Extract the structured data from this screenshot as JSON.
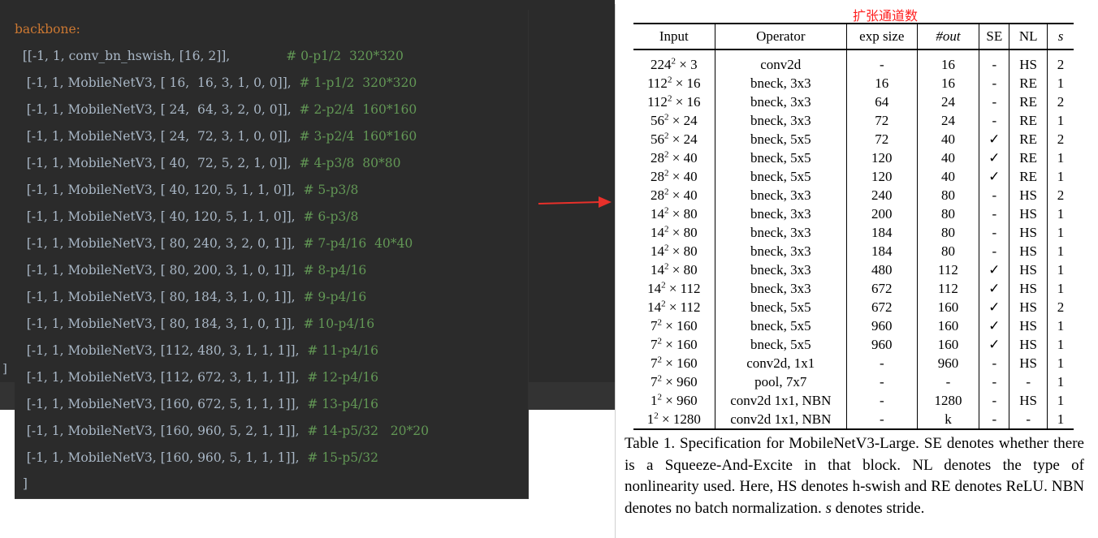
{
  "editor": {
    "header_line": "backbone:",
    "lines": [
      {
        "code": "  [[-1, 1, conv_bn_hswish, [16, 2]],              ",
        "comment": "# 0-p1/2  320*320"
      },
      {
        "code": "   [-1, 1, MobileNetV3, [ 16,  16, 3, 1, 0, 0]],  ",
        "comment": "# 1-p1/2  320*320"
      },
      {
        "code": "   [-1, 1, MobileNetV3, [ 24,  64, 3, 2, 0, 0]],  ",
        "comment": "# 2-p2/4  160*160"
      },
      {
        "code": "   [-1, 1, MobileNetV3, [ 24,  72, 3, 1, 0, 0]],  ",
        "comment": "# 3-p2/4  160*160"
      },
      {
        "code": "   [-1, 1, MobileNetV3, [ 40,  72, 5, 2, 1, 0]],  ",
        "comment": "# 4-p3/8  80*80"
      },
      {
        "code": "   [-1, 1, MobileNetV3, [ 40, 120, 5, 1, 1, 0]],  ",
        "comment": "# 5-p3/8"
      },
      {
        "code": "   [-1, 1, MobileNetV3, [ 40, 120, 5, 1, 1, 0]],  ",
        "comment": "# 6-p3/8"
      },
      {
        "code": "   [-1, 1, MobileNetV3, [ 80, 240, 3, 2, 0, 1]],  ",
        "comment": "# 7-p4/16  40*40"
      },
      {
        "code": "   [-1, 1, MobileNetV3, [ 80, 200, 3, 1, 0, 1]],  ",
        "comment": "# 8-p4/16"
      },
      {
        "code": "   [-1, 1, MobileNetV3, [ 80, 184, 3, 1, 0, 1]],  ",
        "comment": "# 9-p4/16"
      },
      {
        "code": "   [-1, 1, MobileNetV3, [ 80, 184, 3, 1, 0, 1]],  ",
        "comment": "# 10-p4/16"
      },
      {
        "code": "   [-1, 1, MobileNetV3, [112, 480, 3, 1, 1, 1]],  ",
        "comment": "# 11-p4/16"
      },
      {
        "code": "   [-1, 1, MobileNetV3, [112, 672, 3, 1, 1, 1]],  ",
        "comment": "# 12-p4/16"
      },
      {
        "code": "   [-1, 1, MobileNetV3, [160, 672, 5, 1, 1, 1]],  ",
        "comment": "# 13-p4/16"
      },
      {
        "code": "   [-1, 1, MobileNetV3, [160, 960, 5, 2, 1, 1]],  ",
        "comment": "# 14-p5/32   20*20"
      },
      {
        "code": "   [-1, 1, MobileNetV3, [160, 960, 5, 1, 1, 1]],  ",
        "comment": "# 15-p5/32"
      }
    ],
    "closing_line": "  ]",
    "gutter_bracket": "]"
  },
  "annotation": "扩张通道数",
  "table": {
    "headers": [
      "Input",
      "Operator",
      "exp size",
      "#out",
      "SE",
      "NL",
      "s"
    ],
    "rows": [
      {
        "base": "224",
        "exp": "2",
        "mult": "3",
        "op": "conv2d",
        "es": "-",
        "out": "16",
        "se": "-",
        "nl": "HS",
        "s": "2"
      },
      {
        "base": "112",
        "exp": "2",
        "mult": "16",
        "op": "bneck, 3x3",
        "es": "16",
        "out": "16",
        "se": "-",
        "nl": "RE",
        "s": "1"
      },
      {
        "base": "112",
        "exp": "2",
        "mult": "16",
        "op": "bneck, 3x3",
        "es": "64",
        "out": "24",
        "se": "-",
        "nl": "RE",
        "s": "2"
      },
      {
        "base": "56",
        "exp": "2",
        "mult": "24",
        "op": "bneck, 3x3",
        "es": "72",
        "out": "24",
        "se": "-",
        "nl": "RE",
        "s": "1"
      },
      {
        "base": "56",
        "exp": "2",
        "mult": "24",
        "op": "bneck, 5x5",
        "es": "72",
        "out": "40",
        "se": "✓",
        "nl": "RE",
        "s": "2"
      },
      {
        "base": "28",
        "exp": "2",
        "mult": "40",
        "op": "bneck, 5x5",
        "es": "120",
        "out": "40",
        "se": "✓",
        "nl": "RE",
        "s": "1"
      },
      {
        "base": "28",
        "exp": "2",
        "mult": "40",
        "op": "bneck, 5x5",
        "es": "120",
        "out": "40",
        "se": "✓",
        "nl": "RE",
        "s": "1"
      },
      {
        "base": "28",
        "exp": "2",
        "mult": "40",
        "op": "bneck, 3x3",
        "es": "240",
        "out": "80",
        "se": "-",
        "nl": "HS",
        "s": "2"
      },
      {
        "base": "14",
        "exp": "2",
        "mult": "80",
        "op": "bneck, 3x3",
        "es": "200",
        "out": "80",
        "se": "-",
        "nl": "HS",
        "s": "1"
      },
      {
        "base": "14",
        "exp": "2",
        "mult": "80",
        "op": "bneck, 3x3",
        "es": "184",
        "out": "80",
        "se": "-",
        "nl": "HS",
        "s": "1"
      },
      {
        "base": "14",
        "exp": "2",
        "mult": "80",
        "op": "bneck, 3x3",
        "es": "184",
        "out": "80",
        "se": "-",
        "nl": "HS",
        "s": "1"
      },
      {
        "base": "14",
        "exp": "2",
        "mult": "80",
        "op": "bneck, 3x3",
        "es": "480",
        "out": "112",
        "se": "✓",
        "nl": "HS",
        "s": "1"
      },
      {
        "base": "14",
        "exp": "2",
        "mult": "112",
        "op": "bneck, 3x3",
        "es": "672",
        "out": "112",
        "se": "✓",
        "nl": "HS",
        "s": "1"
      },
      {
        "base": "14",
        "exp": "2",
        "mult": "112",
        "op": "bneck, 5x5",
        "es": "672",
        "out": "160",
        "se": "✓",
        "nl": "HS",
        "s": "2"
      },
      {
        "base": "7",
        "exp": "2",
        "mult": "160",
        "op": "bneck, 5x5",
        "es": "960",
        "out": "160",
        "se": "✓",
        "nl": "HS",
        "s": "1"
      },
      {
        "base": "7",
        "exp": "2",
        "mult": "160",
        "op": "bneck, 5x5",
        "es": "960",
        "out": "160",
        "se": "✓",
        "nl": "HS",
        "s": "1"
      },
      {
        "base": "7",
        "exp": "2",
        "mult": "160",
        "op": "conv2d, 1x1",
        "es": "-",
        "out": "960",
        "se": "-",
        "nl": "HS",
        "s": "1"
      },
      {
        "base": "7",
        "exp": "2",
        "mult": "960",
        "op": "pool, 7x7",
        "es": "-",
        "out": "-",
        "se": "-",
        "nl": "-",
        "s": "1"
      },
      {
        "base": "1",
        "exp": "2",
        "mult": "960",
        "op": "conv2d 1x1, NBN",
        "es": "-",
        "out": "1280",
        "se": "-",
        "nl": "HS",
        "s": "1"
      },
      {
        "base": "1",
        "exp": "2",
        "mult": "1280",
        "op": "conv2d 1x1, NBN",
        "es": "-",
        "out": "k",
        "se": "-",
        "nl": "-",
        "s": "1"
      }
    ]
  },
  "caption": {
    "p1": "Table 1. Specification for MobileNetV3-Large.  SE denotes whether there is a Squeeze-And-Excite in that block. NL denotes the type of nonlinearity used. Here, HS denotes h-swish and RE denotes ReLU. NBN denotes no batch normalization. ",
    "s_symbol": "s",
    "p2": " denotes stride."
  },
  "colors": {
    "editor_bg": "#2b2b2b",
    "code_text": "#a9b7c6",
    "keyword": "#cc7832",
    "comment": "#629755",
    "annotation": "#ff2020",
    "arrow": "#e8302a"
  }
}
